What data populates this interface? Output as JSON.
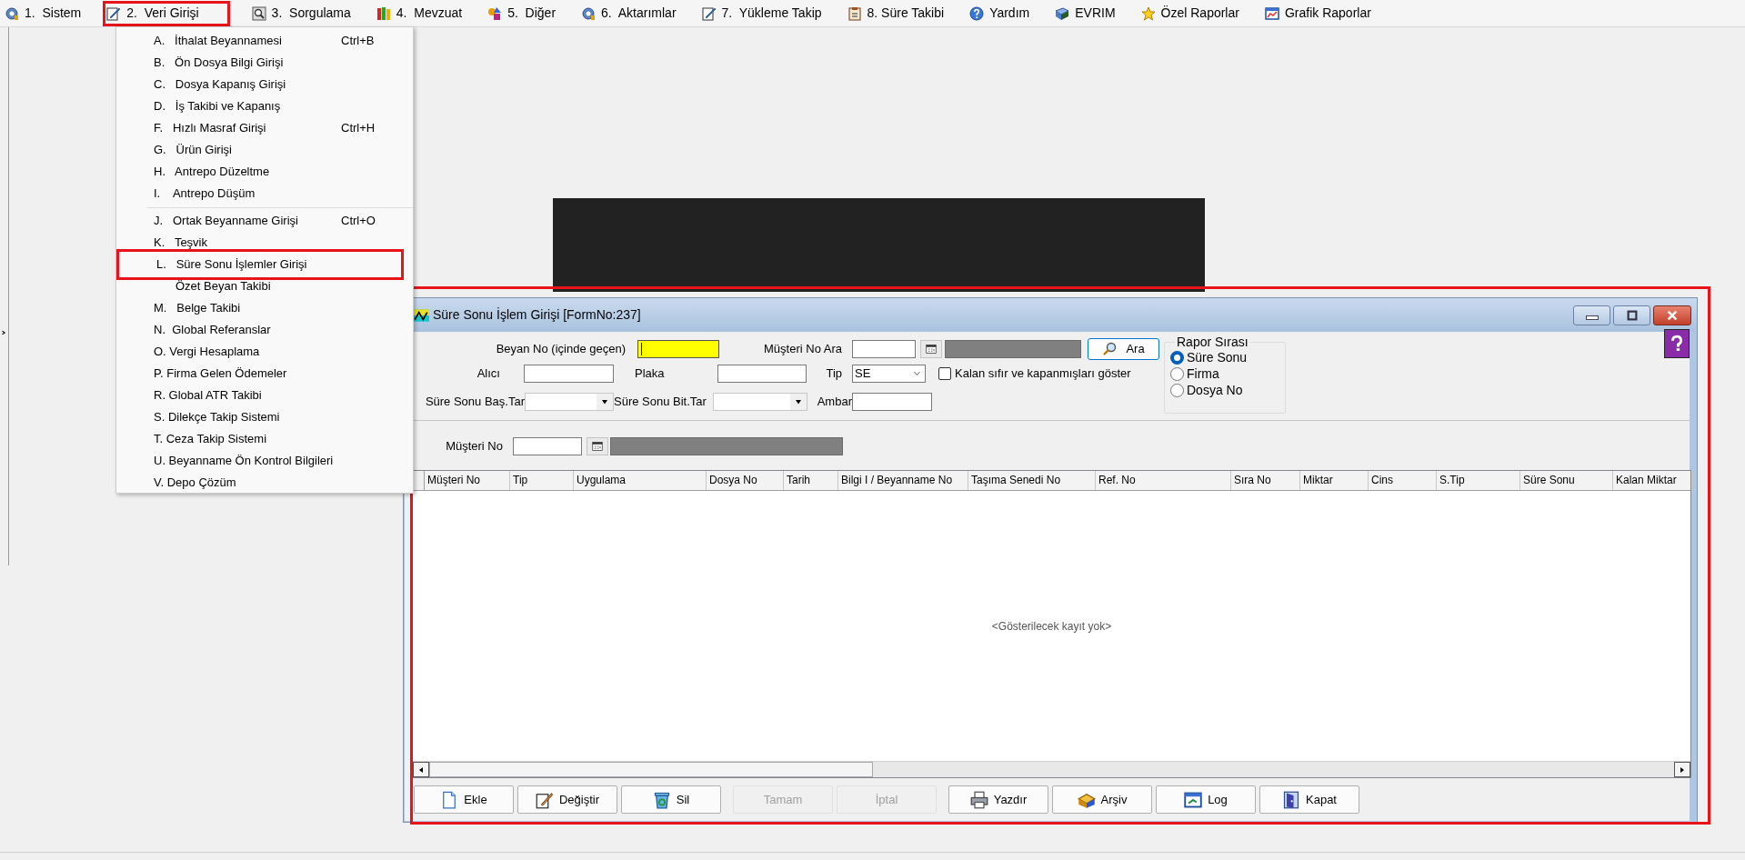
{
  "menu_bar": [
    {
      "label": "1.  Sistem",
      "highlighted": false
    },
    {
      "label": "2.  Veri Girişi",
      "highlighted": true
    },
    {
      "label": "3.  Sorgulama",
      "highlighted": false
    },
    {
      "label": "4.  Mevzuat",
      "highlighted": false
    },
    {
      "label": "5.  Diğer",
      "highlighted": false
    },
    {
      "label": "6.  Aktarımlar",
      "highlighted": false
    },
    {
      "label": "7.  Yükleme Takip",
      "highlighted": false
    },
    {
      "label": "8. Süre Takibi",
      "highlighted": false
    },
    {
      "label": "Yardım",
      "highlighted": false
    },
    {
      "label": "EVRIM",
      "highlighted": false
    },
    {
      "label": "Özel Raporlar",
      "highlighted": false
    },
    {
      "label": "Grafik Raporlar",
      "highlighted": false
    }
  ],
  "dropdown": [
    {
      "kind": "item",
      "text": "A.   İthalat Beyannamesi",
      "shortcut": "Ctrl+B",
      "highlighted": false
    },
    {
      "kind": "item",
      "text": "B.   Ön Dosya Bilgi Girişi",
      "highlighted": false
    },
    {
      "kind": "item",
      "text": "C.   Dosya Kapanış Girişi",
      "highlighted": false
    },
    {
      "kind": "item",
      "text": "D.   İş Takibi ve Kapanış",
      "highlighted": false
    },
    {
      "kind": "item",
      "text": "F.   Hızlı Masraf Girişi",
      "shortcut": "Ctrl+H",
      "highlighted": false
    },
    {
      "kind": "item",
      "text": "G.   Ürün Girişi",
      "highlighted": false
    },
    {
      "kind": "item",
      "text": "H.   Antrepo Düzeltme",
      "highlighted": false
    },
    {
      "kind": "item",
      "text": "I.    Antrepo Düşüm",
      "highlighted": false
    },
    {
      "kind": "separator"
    },
    {
      "kind": "item",
      "text": "J.   Ortak Beyanname Girişi",
      "shortcut": "Ctrl+O",
      "highlighted": false
    },
    {
      "kind": "item",
      "text": "K.   Teşvik",
      "highlighted": false
    },
    {
      "kind": "item",
      "text": "L.   Süre Sonu İşlemler Girişi",
      "highlighted": true
    },
    {
      "kind": "sub",
      "text": "Özet Beyan Takibi",
      "highlighted": false
    },
    {
      "kind": "item",
      "text": "M.   Belge Takibi",
      "highlighted": false
    },
    {
      "kind": "item",
      "text": "N.  Global Referanslar",
      "highlighted": false
    },
    {
      "kind": "item",
      "text": "O. Vergi Hesaplama",
      "highlighted": false
    },
    {
      "kind": "item",
      "text": "P. Firma Gelen Ödemeler",
      "highlighted": false
    },
    {
      "kind": "item",
      "text": "R. Global ATR Takibi",
      "highlighted": false
    },
    {
      "kind": "item",
      "text": "S. Dilekçe Takip Sistemi",
      "highlighted": false
    },
    {
      "kind": "item",
      "text": "T. Ceza Takip Sistemi",
      "highlighted": false
    },
    {
      "kind": "item",
      "text": "U. Beyanname Ön Kontrol Bilgileri",
      "highlighted": false
    },
    {
      "kind": "item",
      "text": "V. Depo Çözüm",
      "highlighted": false
    }
  ],
  "window": {
    "title": "Süre Sonu İşlem Girişi [FormNo:237]",
    "highlighted": true,
    "form": {
      "beyan_no": {
        "label": "Beyan No (içinde geçen)",
        "focused": true
      },
      "musteri_no_ara": {
        "label": "Müşteri No Ara"
      },
      "ara_button": "Ara",
      "alici": {
        "label": "Alıcı"
      },
      "plaka": {
        "label": "Plaka"
      },
      "tip": {
        "label": "Tip",
        "value": "SE"
      },
      "show_closed": {
        "label": "Kalan sıfır ve kapanmışları göster",
        "checked": false
      },
      "bas_tar": {
        "label": "Süre Sonu Baş.Tar"
      },
      "bit_tar": {
        "label": "Süre Sonu Bit.Tar"
      },
      "ambar": {
        "label": "Ambar"
      },
      "musteri_no": {
        "label": "Müşteri No"
      },
      "rapor_sirasi": {
        "title": "Rapor Sırası",
        "options": [
          {
            "label": "Süre Sonu",
            "selected": true
          },
          {
            "label": "Firma",
            "selected": false
          },
          {
            "label": "Dosya No",
            "selected": false
          }
        ]
      }
    },
    "table": {
      "columns": [
        "Müşteri No",
        "Tip",
        "Uygulama",
        "Dosya No",
        "Tarih",
        "Bilgi I / Beyanname No",
        "Taşıma Senedi No",
        "Ref. No",
        "Sıra No",
        "Miktar",
        "Cins",
        "S.Tip",
        "Süre Sonu",
        "Kalan Miktar"
      ],
      "empty_text": "<Gösterilecek kayıt yok>"
    },
    "buttons": [
      {
        "label": "Ekle",
        "disabled": false
      },
      {
        "label": "Değiştir",
        "disabled": false
      },
      {
        "label": "Sil",
        "disabled": false
      },
      {
        "label": "Tamam",
        "disabled": true
      },
      {
        "label": "İptal",
        "disabled": true
      },
      {
        "label": "Yazdır",
        "disabled": false
      },
      {
        "label": "Arşiv",
        "disabled": false
      },
      {
        "label": "Log",
        "disabled": false
      },
      {
        "label": "Kapat",
        "disabled": false
      }
    ]
  }
}
